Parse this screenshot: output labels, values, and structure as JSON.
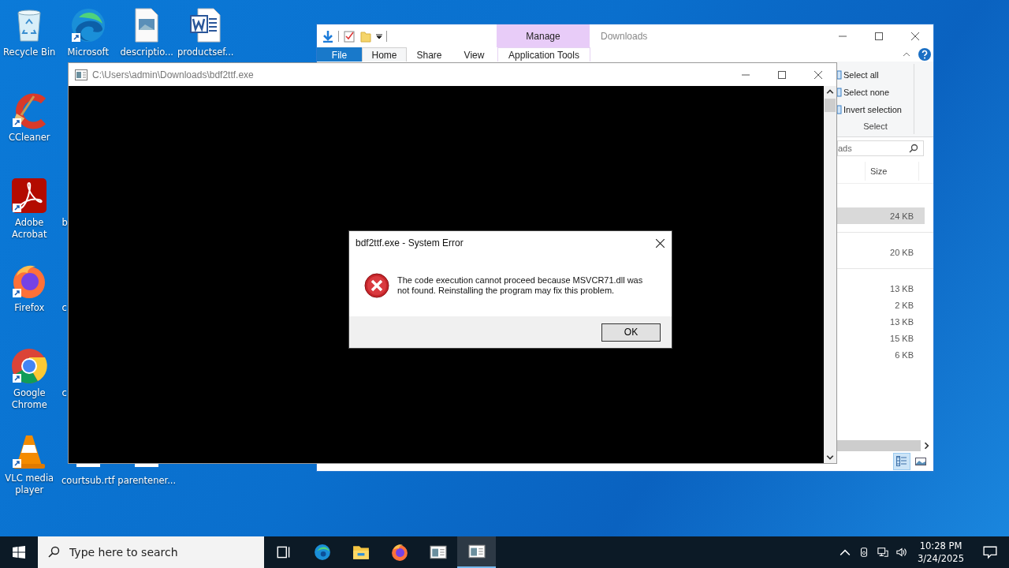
{
  "desktop_columns": [
    [
      {
        "label": "Recycle Bin",
        "kind": "recycle"
      },
      {
        "label": "CCleaner",
        "kind": "ccleaner"
      },
      {
        "label": "Adobe Acrobat",
        "kind": "acrobat"
      },
      {
        "label": "Firefox",
        "kind": "firefox"
      },
      {
        "label": "Google Chrome",
        "kind": "chrome"
      },
      {
        "label": "VLC media player",
        "kind": "vlc"
      }
    ],
    [
      {
        "label": "Microsoft",
        "kind": "edge"
      },
      null,
      {
        "label": "b",
        "kind": "covered"
      },
      {
        "label": "c",
        "kind": "covered"
      },
      {
        "label": "c",
        "kind": "covered"
      },
      {
        "label": "courtsub.rtf",
        "kind": "file"
      }
    ],
    [
      {
        "label": "descriptio...",
        "kind": "image-file"
      },
      null,
      null,
      null,
      null,
      {
        "label": "parentener...",
        "kind": "file"
      }
    ],
    [
      {
        "label": "productsef...",
        "kind": "word"
      }
    ]
  ],
  "explorer": {
    "title": "Downloads",
    "context_tab": "Manage",
    "tabs": [
      {
        "label": "File",
        "kind": "file",
        "selected": false
      },
      {
        "label": "Home",
        "kind": "tab",
        "selected": true
      },
      {
        "label": "Share",
        "kind": "tab",
        "selected": false
      },
      {
        "label": "View",
        "kind": "tab",
        "selected": false
      },
      {
        "label": "Application Tools",
        "kind": "tab",
        "selected": false
      }
    ],
    "select_group": {
      "items": [
        "Select all",
        "Select none",
        "Invert selection"
      ],
      "label": "Select"
    },
    "search": {
      "placeholder": "ads"
    },
    "size_column": "Size",
    "groups": [
      {
        "rows": [
          {
            "size": "24 KB",
            "selected": true
          }
        ]
      },
      {
        "rows": [
          {
            "size": "20 KB",
            "selected": false
          }
        ]
      },
      {
        "rows": [
          {
            "size": "13 KB",
            "selected": false
          },
          {
            "size": "2 KB",
            "selected": false
          },
          {
            "size": "13 KB",
            "selected": false
          },
          {
            "size": "15 KB",
            "selected": false
          },
          {
            "size": "6 KB",
            "selected": false
          }
        ]
      }
    ]
  },
  "console": {
    "title": "C:\\Users\\admin\\Downloads\\bdf2ttf.exe"
  },
  "dialog": {
    "title": "bdf2ttf.exe - System Error",
    "message": "The code execution cannot proceed because MSVCR71.dll was not found. Reinstalling the program may fix this problem.",
    "button": "OK"
  },
  "taskbar": {
    "search": {
      "placeholder": "Type here to search"
    },
    "apps": [
      {
        "kind": "task-view",
        "selected": false
      },
      {
        "kind": "edge",
        "selected": false
      },
      {
        "kind": "folder",
        "selected": false
      },
      {
        "kind": "firefox",
        "selected": false
      },
      {
        "kind": "window",
        "selected": false
      },
      {
        "kind": "window",
        "selected": true
      }
    ],
    "time": "10:28 PM",
    "date": "3/24/2025"
  }
}
